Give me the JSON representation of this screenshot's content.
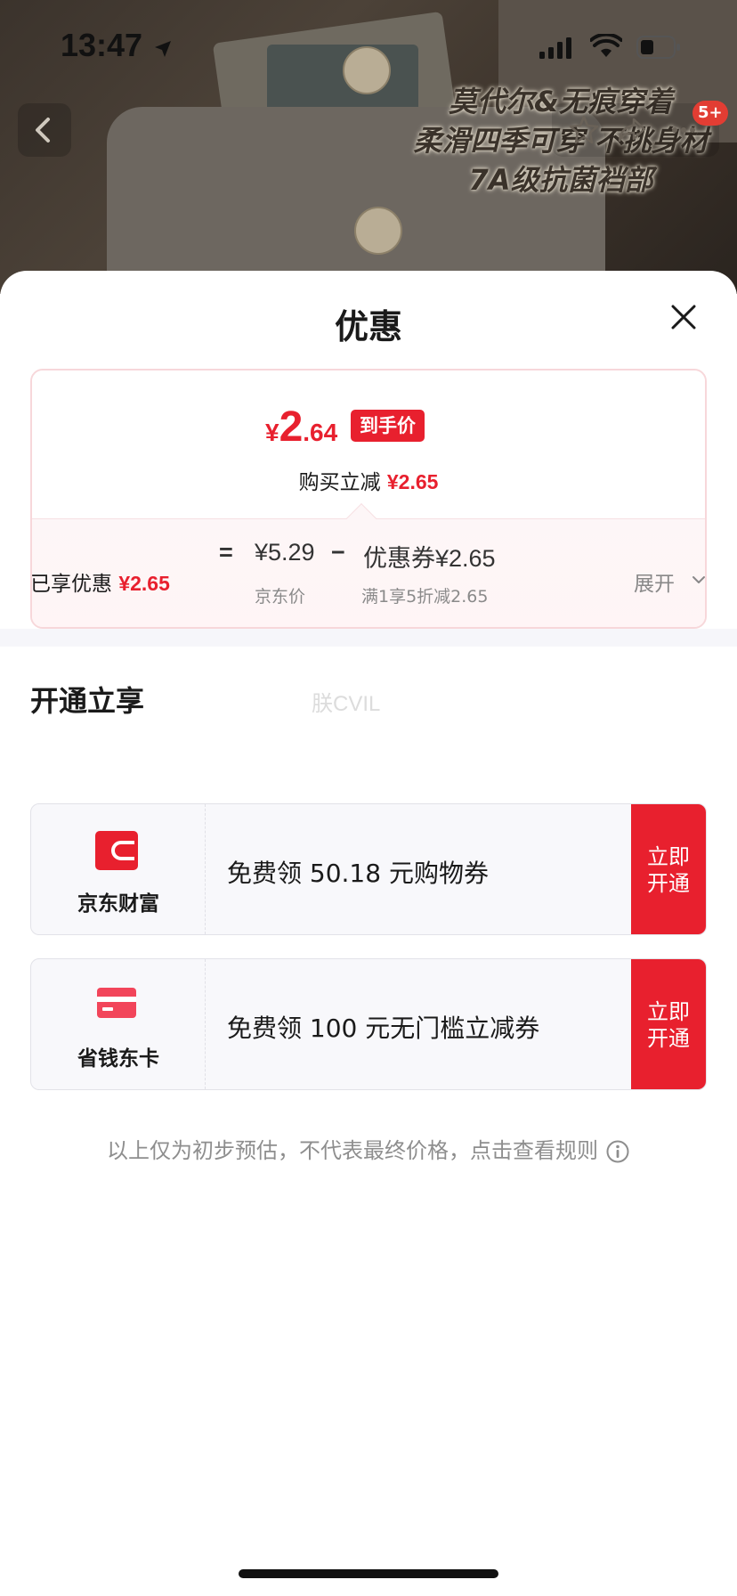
{
  "status_bar": {
    "time": "13:47"
  },
  "background": {
    "promo_lines": [
      "莫代尔&无痕穿着",
      "柔滑四季可穿 不挑身材",
      "7A级抗菌裆部"
    ],
    "cart_badge": "5+"
  },
  "sheet": {
    "title": "优惠",
    "final_price": {
      "currency": "¥",
      "integer": "2",
      "decimal": ".64",
      "tag": "到手价"
    },
    "save_label": "购买立减",
    "save_amount": "¥2.65",
    "formula": {
      "equals": "=",
      "jd_price": "¥5.29",
      "minus": "−",
      "coupon": "优惠券¥2.65",
      "jd_price_label": "京东价",
      "coupon_rule": "满1享5折减2.65"
    },
    "enjoyed_label": "已享优惠",
    "enjoyed_amount": "¥2.65",
    "expand_label": "展开",
    "open_section_title": "开通立享",
    "watermark": "朕CVIL",
    "offers": [
      {
        "brand": "京东财富",
        "icon": "wallet-icon",
        "desc": "免费领 50.18 元购物券",
        "cta_line1": "立即",
        "cta_line2": "开通"
      },
      {
        "brand": "省钱东卡",
        "icon": "card-icon",
        "desc": "免费领 100 元无门槛立减券",
        "cta_line1": "立即",
        "cta_line2": "开通"
      }
    ],
    "disclaimer": "以上仅为初步预估，不代表最终价格，点击查看规则"
  },
  "colors": {
    "accent_red": "#e8202e",
    "background_dim": "#3b332c"
  }
}
